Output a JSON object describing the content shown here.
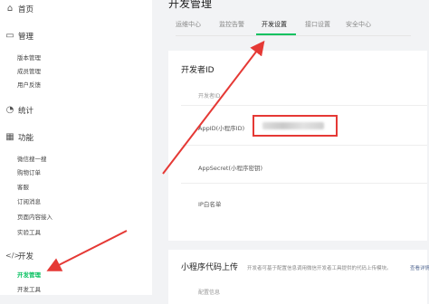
{
  "sidebar": {
    "home_label": "首页",
    "manage_label": "管理",
    "manage_items": [
      "版本管理",
      "成员管理",
      "用户反馈"
    ],
    "stats_label": "统计",
    "features_label": "功能",
    "feature_items": [
      "微信搜一搜",
      "购物订单",
      "客服",
      "订阅消息",
      "页面内容接入",
      "实验工具"
    ],
    "dev_label": "开发",
    "dev_items": [
      "开发管理",
      "开发工具"
    ]
  },
  "header": {
    "title": "开发管理",
    "tabs": [
      "运维中心",
      "监控告警",
      "开发设置",
      "接口设置",
      "安全中心"
    ],
    "active_tab": "开发设置"
  },
  "dev_id_card": {
    "title": "开发者ID",
    "column_header": "开发者ID",
    "rows": [
      "AppID(小程序ID)",
      "AppSecret(小程序密钥)",
      "IP白名单"
    ]
  },
  "upload_card": {
    "title": "小程序代码上传",
    "description": "开发者可基于配置信息调用微信开发者工具提供的代码上传模块。",
    "link": "查看详情",
    "column_header": "配置信息"
  },
  "colors": {
    "accent": "#07c160",
    "highlight": "#e53935"
  }
}
